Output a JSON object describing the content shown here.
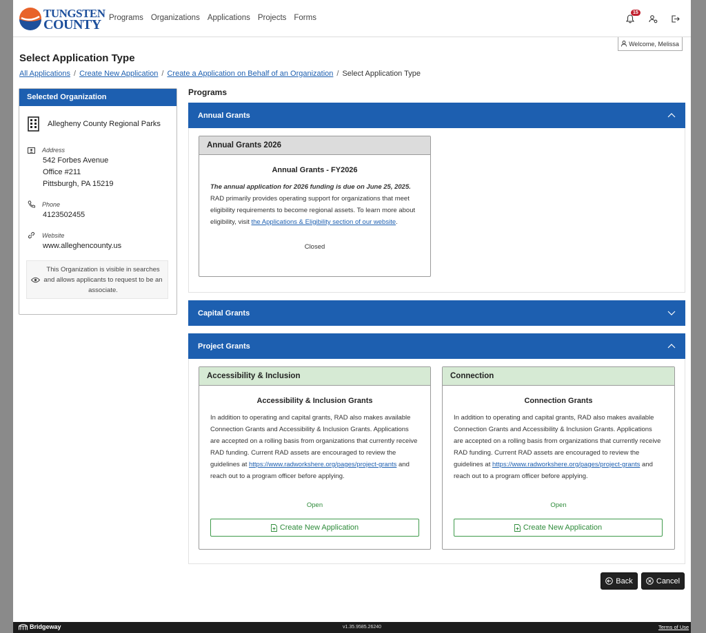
{
  "brand": {
    "line1": "TUNGSTEN",
    "line2": "COUNTY"
  },
  "nav": [
    "Programs",
    "Organizations",
    "Applications",
    "Projects",
    "Forms"
  ],
  "notifications": {
    "count": "15"
  },
  "welcome": "Welcome, Melissa",
  "page": {
    "title": "Select Application Type"
  },
  "breadcrumb": {
    "b1": "All Applications",
    "b2": "Create New Application",
    "b3": "Create a Application on Behalf of an Organization",
    "current": "Select Application Type"
  },
  "org": {
    "header": "Selected Organization",
    "name": "Allegheny County Regional Parks",
    "address_label": "Address",
    "address": [
      "542 Forbes Avenue",
      "Office #211",
      "Pittsburgh, PA 15219"
    ],
    "phone_label": "Phone",
    "phone": "4123502455",
    "website_label": "Website",
    "website": "www.alleghencounty.us",
    "visibility_note": "This Organization is visible in searches and allows applicants to request to be an associate."
  },
  "programs": {
    "heading": "Programs",
    "annual": {
      "title": "Annual Grants",
      "card": {
        "header": "Annual Grants 2026",
        "title": "Annual Grants - FY2026",
        "desc_bold": "The annual application for 2026 funding is due on June 25, 2025.",
        "desc": " RAD primarily provides operating support for organizations that meet eligibility requirements to become regional assets. To learn more about eligibility, visit ",
        "link": "the Applications & Eligibility section of our website",
        "desc_end": ".",
        "status": "Closed"
      }
    },
    "capital": {
      "title": "Capital Grants"
    },
    "project": {
      "title": "Project Grants",
      "cards": [
        {
          "header": "Accessibility & Inclusion",
          "title": "Accessibility & Inclusion Grants",
          "desc": "In addition to operating and capital grants, RAD also makes available Connection Grants and Accessibility & Inclusion Grants. Applications are accepted on a rolling basis from organizations that currently receive RAD funding. Current RAD assets are encouraged to review the guidelines at ",
          "link": "https://www.radworkshere.org/pages/project-grants",
          "desc_end": " and reach out to a program officer before applying.",
          "status": "Open",
          "button": "Create New Application"
        },
        {
          "header": "Connection",
          "title": "Connection Grants",
          "desc": "In addition to operating and capital grants, RAD also makes available Connection Grants and Accessibility & Inclusion Grants. Applications are accepted on a rolling basis from organizations that currently receive RAD funding. Current RAD assets are encouraged to review the guidelines at ",
          "link": "https://www.radworkshere.org/pages/project-grants",
          "desc_end": " and reach out to a program officer before applying.",
          "status": "Open",
          "button": "Create New Application"
        }
      ]
    }
  },
  "actions": {
    "back": "Back",
    "cancel": "Cancel"
  },
  "footer": {
    "brand": "Bridgeway",
    "version": "v1.35.9585.26240",
    "terms": "Terms of Use"
  },
  "colors": {
    "primary": "#1d5fb0",
    "success": "#2e8b3a",
    "card_header_green": "#d6ead4",
    "card_header_gray": "#dcdcdc",
    "badge": "#c0202e"
  }
}
